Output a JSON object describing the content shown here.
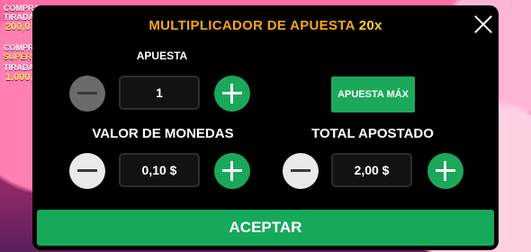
{
  "background": {
    "left_texts": [
      "COMPRA",
      "TIRADAS",
      "200,0",
      "COMPRA",
      "SUPER",
      "TIRADAS",
      "1.000,"
    ]
  },
  "modal": {
    "title": "MULTIPLICADOR DE APUESTA",
    "multiplier": "20x",
    "bet_label": "APUESTA",
    "bet_value": "1",
    "max_bet_label": "APUESTA MÁX",
    "coin_value_label": "VALOR DE MONEDAS",
    "coin_value": "0,10 $",
    "total_bet_label": "TOTAL APOSTADO",
    "total_bet_value": "2,00 $",
    "accept_label": "ACEPTAR"
  },
  "colors": {
    "title": "#f7a51a",
    "green": "#1aa85b",
    "modal_bg": "#000000"
  },
  "icons": [
    "close-icon",
    "minus-icon",
    "plus-icon"
  ]
}
